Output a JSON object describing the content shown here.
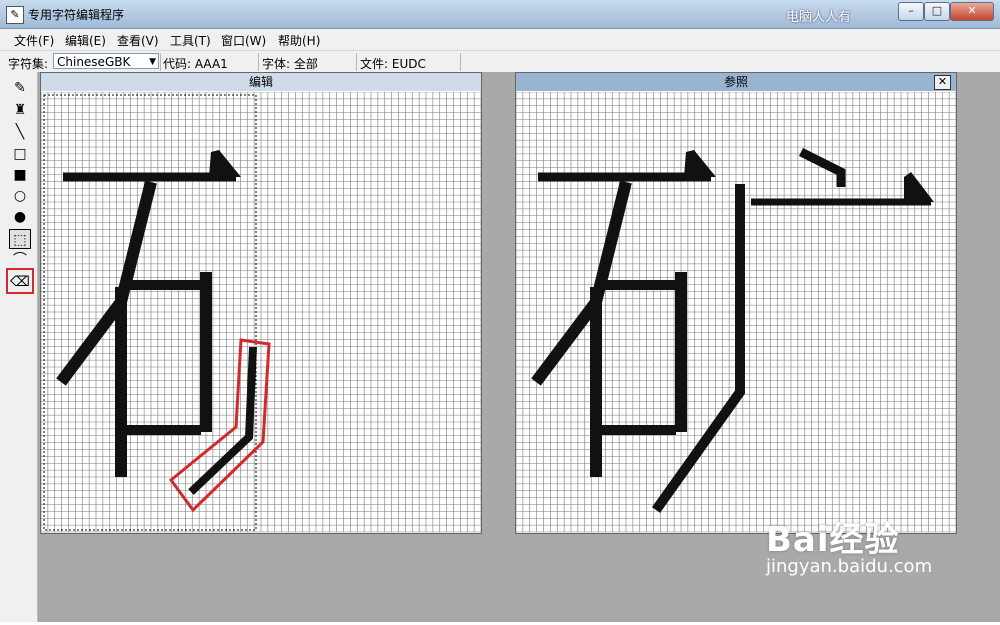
{
  "window": {
    "title": "专用字符编辑程序",
    "watermark": "电脑人人有",
    "min_glyph": "–",
    "max_glyph": "□",
    "close_glyph": "✕"
  },
  "menu": [
    "文件(F)",
    "编辑(E)",
    "查看(V)",
    "工具(T)",
    "窗口(W)",
    "帮助(H)"
  ],
  "info": {
    "charset_label": "字符集:",
    "charset_value": "ChineseGBK",
    "code": "代码: AAA1",
    "font": "字体: 全部",
    "file": "文件: EUDC"
  },
  "tools": [
    {
      "icon": "pencil-icon",
      "glyph": "✎",
      "selected": false
    },
    {
      "icon": "brush-icon",
      "glyph": "♜",
      "selected": false
    },
    {
      "icon": "line-icon",
      "glyph": "╲",
      "selected": false
    },
    {
      "icon": "hollow-rectangle-icon",
      "glyph": "□",
      "selected": false
    },
    {
      "icon": "filled-rectangle-icon",
      "glyph": "■",
      "selected": false
    },
    {
      "icon": "hollow-ellipse-icon",
      "glyph": "○",
      "selected": false
    },
    {
      "icon": "filled-ellipse-icon",
      "glyph": "●",
      "selected": false
    },
    {
      "icon": "rect-select-icon",
      "glyph": "⬚",
      "selected": true
    },
    {
      "icon": "freeform-select-icon",
      "glyph": "⌒",
      "selected": false
    },
    {
      "icon": "eraser-icon",
      "glyph": "⌫",
      "selected": false
    }
  ],
  "edit_panel": {
    "title": "编辑"
  },
  "ref_panel": {
    "title": "参照",
    "close_glyph": "✕"
  },
  "logo": {
    "text": "Bai经验",
    "url": "jingyan.baidu.com"
  },
  "colors": {
    "highlight": "#d12a2a",
    "ink": "#111111",
    "grid": "#7a7a7a"
  }
}
